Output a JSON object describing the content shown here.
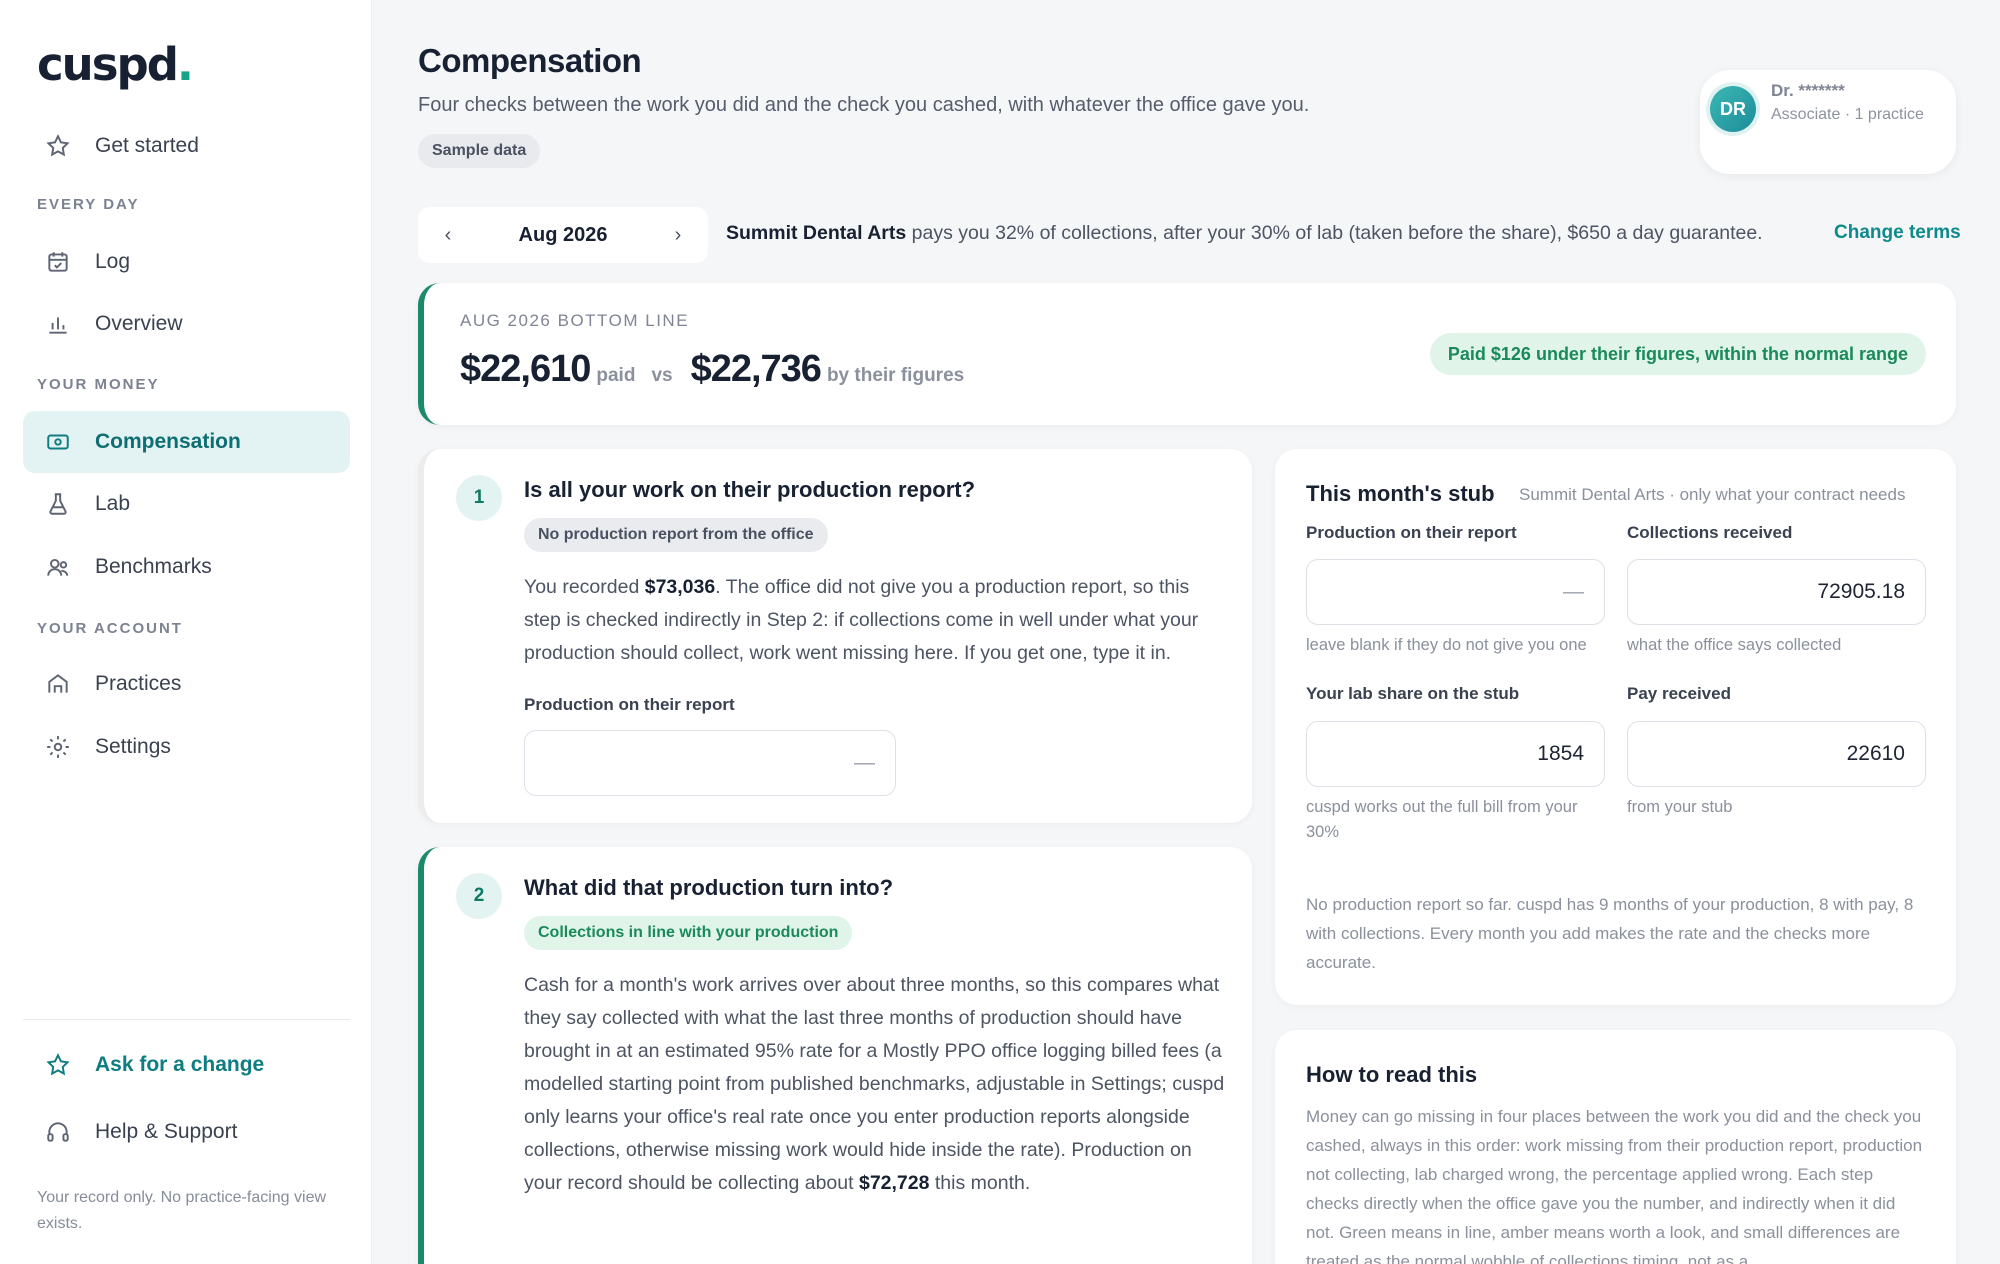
{
  "sidebar": {
    "logo": "cuspd",
    "logo_dot": ".",
    "items": {
      "get_started": "Get started",
      "log": "Log",
      "overview": "Overview",
      "compensation": "Compensation",
      "lab": "Lab",
      "benchmarks": "Benchmarks",
      "practices": "Practices",
      "settings": "Settings",
      "ask_change": "Ask for a change",
      "help": "Help & Support"
    },
    "sections": {
      "every_day": "EVERY DAY",
      "your_money": "YOUR MONEY",
      "your_account": "YOUR ACCOUNT"
    },
    "footer": "Your record only. No practice-facing view exists."
  },
  "header": {
    "title": "Compensation",
    "subtitle": "Four checks between the work you did and the check you cashed, with whatever the office gave you.",
    "sample_chip": "Sample data"
  },
  "user": {
    "initials": "DR",
    "name": "Dr. *******",
    "role": "Associate · 1 practice"
  },
  "month_nav": {
    "prev": "‹",
    "month": "Aug 2026",
    "next": "›"
  },
  "terms": {
    "practice": "Summit Dental Arts",
    "text": " pays you 32% of collections, after your 30% of lab (taken before the share), $650 a day guarantee.",
    "change_link": "Change terms"
  },
  "bottom_line": {
    "label": "AUG 2026 BOTTOM LINE",
    "paid_amount": "$22,610",
    "paid_label": "paid",
    "vs": "vs",
    "their_amount": "$22,736",
    "their_label": "by their figures",
    "status": "Paid $126 under their figures, within the normal range"
  },
  "step1": {
    "number": "1",
    "title": "Is all your work on their production report?",
    "chip": "No production report from the office",
    "body_a": "You recorded ",
    "body_amount": "$73,036",
    "body_b": ". The office did not give you a production report, so this step is checked indirectly in Step 2: if collections come in well under what your production should collect, work went missing here. If you get one, type it in.",
    "field_label": "Production on their report",
    "field_value": "—"
  },
  "step2": {
    "number": "2",
    "title": "What did that production turn into?",
    "chip": "Collections in line with your production",
    "body_a": "Cash for a month's work arrives over about three months, so this compares what they say collected with what the last three months of production should have brought in at an estimated 95% rate for a Mostly PPO office logging billed fees (a modelled starting point from published benchmarks, adjustable in Settings; cuspd only learns your office's real rate once you enter production reports alongside collections, otherwise missing work would hide inside the rate). Production on your record should be collecting about ",
    "body_amount": "$72,728",
    "body_b": " this month."
  },
  "stub": {
    "title": "This month's stub",
    "subtitle": "Summit Dental Arts · only what your contract needs",
    "fields": {
      "production": {
        "label": "Production on their report",
        "value": "—",
        "help": "leave blank if they do not give you one"
      },
      "collections": {
        "label": "Collections received",
        "value": "72905.18",
        "help": "what the office says collected"
      },
      "lab_share": {
        "label": "Your lab share on the stub",
        "value": "1854",
        "help": "cuspd works out the full bill from your 30%"
      },
      "pay": {
        "label": "Pay received",
        "value": "22610",
        "help": "from your stub"
      }
    },
    "note": "No production report so far. cuspd has 9 months of your production, 8 with pay, 8 with collections. Every month you add makes the rate and the checks more accurate."
  },
  "howto": {
    "title": "How to read this",
    "body": "Money can go missing in four places between the work you did and the check you cashed, always in this order: work missing from their production report, production not collecting, lab charged wrong, the percentage applied wrong. Each step checks directly when the office gave you the number, and indirectly when it did not. Green means in line, amber means worth a look, and small differences are treated as the normal wobble of collections timing, not as a"
  },
  "colors": {
    "accent": "#0e7c80",
    "success": "#1a8a5a",
    "active_bg": "#e3f3f3"
  },
  "icons": {
    "get_started": "star-icon",
    "log": "calendar-icon",
    "overview": "bar-chart-icon",
    "compensation": "banknote-icon",
    "lab": "flask-icon",
    "benchmarks": "users-icon",
    "practices": "building-icon",
    "settings": "gear-icon",
    "ask_change": "star-icon",
    "help": "headset-icon"
  }
}
